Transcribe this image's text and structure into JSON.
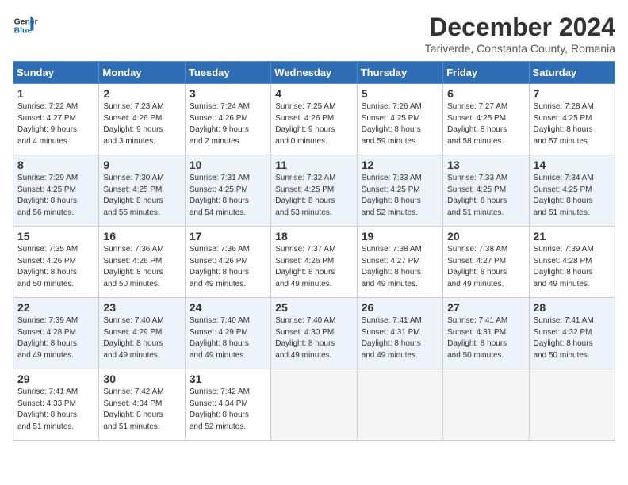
{
  "header": {
    "logo_line1": "General",
    "logo_line2": "Blue",
    "month": "December 2024",
    "location": "Tariverde, Constanta County, Romania"
  },
  "weekdays": [
    "Sunday",
    "Monday",
    "Tuesday",
    "Wednesday",
    "Thursday",
    "Friday",
    "Saturday"
  ],
  "weeks": [
    [
      {
        "day": "1",
        "info": "Sunrise: 7:22 AM\nSunset: 4:27 PM\nDaylight: 9 hours\nand 4 minutes."
      },
      {
        "day": "2",
        "info": "Sunrise: 7:23 AM\nSunset: 4:26 PM\nDaylight: 9 hours\nand 3 minutes."
      },
      {
        "day": "3",
        "info": "Sunrise: 7:24 AM\nSunset: 4:26 PM\nDaylight: 9 hours\nand 2 minutes."
      },
      {
        "day": "4",
        "info": "Sunrise: 7:25 AM\nSunset: 4:26 PM\nDaylight: 9 hours\nand 0 minutes."
      },
      {
        "day": "5",
        "info": "Sunrise: 7:26 AM\nSunset: 4:25 PM\nDaylight: 8 hours\nand 59 minutes."
      },
      {
        "day": "6",
        "info": "Sunrise: 7:27 AM\nSunset: 4:25 PM\nDaylight: 8 hours\nand 58 minutes."
      },
      {
        "day": "7",
        "info": "Sunrise: 7:28 AM\nSunset: 4:25 PM\nDaylight: 8 hours\nand 57 minutes."
      }
    ],
    [
      {
        "day": "8",
        "info": "Sunrise: 7:29 AM\nSunset: 4:25 PM\nDaylight: 8 hours\nand 56 minutes."
      },
      {
        "day": "9",
        "info": "Sunrise: 7:30 AM\nSunset: 4:25 PM\nDaylight: 8 hours\nand 55 minutes."
      },
      {
        "day": "10",
        "info": "Sunrise: 7:31 AM\nSunset: 4:25 PM\nDaylight: 8 hours\nand 54 minutes."
      },
      {
        "day": "11",
        "info": "Sunrise: 7:32 AM\nSunset: 4:25 PM\nDaylight: 8 hours\nand 53 minutes."
      },
      {
        "day": "12",
        "info": "Sunrise: 7:33 AM\nSunset: 4:25 PM\nDaylight: 8 hours\nand 52 minutes."
      },
      {
        "day": "13",
        "info": "Sunrise: 7:33 AM\nSunset: 4:25 PM\nDaylight: 8 hours\nand 51 minutes."
      },
      {
        "day": "14",
        "info": "Sunrise: 7:34 AM\nSunset: 4:25 PM\nDaylight: 8 hours\nand 51 minutes."
      }
    ],
    [
      {
        "day": "15",
        "info": "Sunrise: 7:35 AM\nSunset: 4:26 PM\nDaylight: 8 hours\nand 50 minutes."
      },
      {
        "day": "16",
        "info": "Sunrise: 7:36 AM\nSunset: 4:26 PM\nDaylight: 8 hours\nand 50 minutes."
      },
      {
        "day": "17",
        "info": "Sunrise: 7:36 AM\nSunset: 4:26 PM\nDaylight: 8 hours\nand 49 minutes."
      },
      {
        "day": "18",
        "info": "Sunrise: 7:37 AM\nSunset: 4:26 PM\nDaylight: 8 hours\nand 49 minutes."
      },
      {
        "day": "19",
        "info": "Sunrise: 7:38 AM\nSunset: 4:27 PM\nDaylight: 8 hours\nand 49 minutes."
      },
      {
        "day": "20",
        "info": "Sunrise: 7:38 AM\nSunset: 4:27 PM\nDaylight: 8 hours\nand 49 minutes."
      },
      {
        "day": "21",
        "info": "Sunrise: 7:39 AM\nSunset: 4:28 PM\nDaylight: 8 hours\nand 49 minutes."
      }
    ],
    [
      {
        "day": "22",
        "info": "Sunrise: 7:39 AM\nSunset: 4:28 PM\nDaylight: 8 hours\nand 49 minutes."
      },
      {
        "day": "23",
        "info": "Sunrise: 7:40 AM\nSunset: 4:29 PM\nDaylight: 8 hours\nand 49 minutes."
      },
      {
        "day": "24",
        "info": "Sunrise: 7:40 AM\nSunset: 4:29 PM\nDaylight: 8 hours\nand 49 minutes."
      },
      {
        "day": "25",
        "info": "Sunrise: 7:40 AM\nSunset: 4:30 PM\nDaylight: 8 hours\nand 49 minutes."
      },
      {
        "day": "26",
        "info": "Sunrise: 7:41 AM\nSunset: 4:31 PM\nDaylight: 8 hours\nand 49 minutes."
      },
      {
        "day": "27",
        "info": "Sunrise: 7:41 AM\nSunset: 4:31 PM\nDaylight: 8 hours\nand 50 minutes."
      },
      {
        "day": "28",
        "info": "Sunrise: 7:41 AM\nSunset: 4:32 PM\nDaylight: 8 hours\nand 50 minutes."
      }
    ],
    [
      {
        "day": "29",
        "info": "Sunrise: 7:41 AM\nSunset: 4:33 PM\nDaylight: 8 hours\nand 51 minutes."
      },
      {
        "day": "30",
        "info": "Sunrise: 7:42 AM\nSunset: 4:34 PM\nDaylight: 8 hours\nand 51 minutes."
      },
      {
        "day": "31",
        "info": "Sunrise: 7:42 AM\nSunset: 4:34 PM\nDaylight: 8 hours\nand 52 minutes."
      },
      {
        "day": "",
        "info": ""
      },
      {
        "day": "",
        "info": ""
      },
      {
        "day": "",
        "info": ""
      },
      {
        "day": "",
        "info": ""
      }
    ]
  ]
}
